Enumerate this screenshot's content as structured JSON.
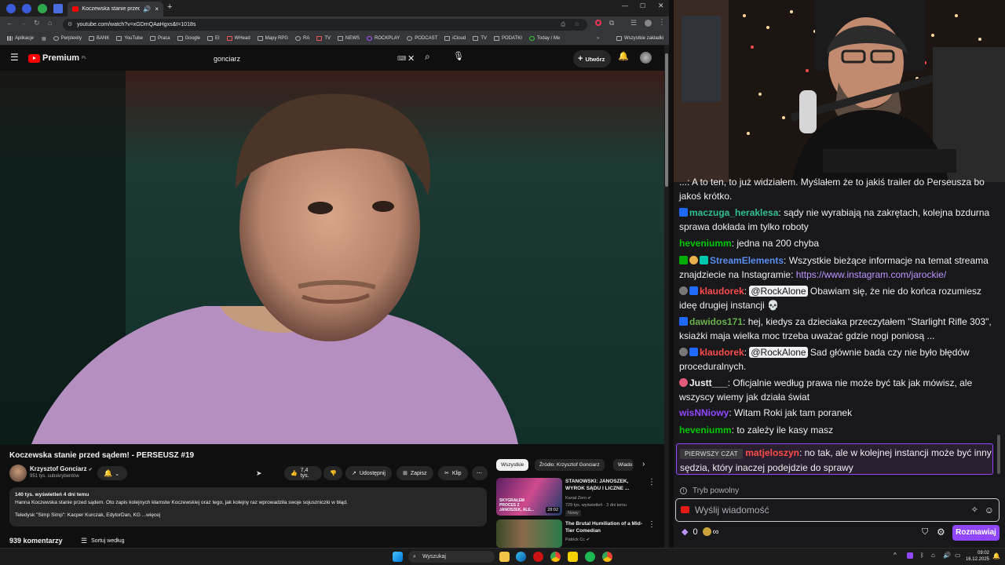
{
  "browser": {
    "tab_title": "Koczewska stanie przed są",
    "url": "youtube.com/watch?v=xGDmQAaHgxs&t=1018s",
    "bookmarks": [
      "Aplikacje",
      "Perplexity",
      "BANK",
      "YouTube",
      "Praca",
      "Google",
      "EI",
      "WHead",
      "Mapy RPG",
      "RA",
      "TV",
      "NEWS",
      "ROCKPLAY",
      "PODCAST",
      "iCloud",
      "TV",
      "PODATKI",
      "Today / Me"
    ],
    "all_bookmarks": "Wszystkie zakładki"
  },
  "yt": {
    "logo_text": "Premium",
    "logo_sup": "PL",
    "search_value": "gonciarz",
    "create_label": "Utwórz",
    "video_title": "Koczewska stanie przed sądem! - PERSEUSZ #19",
    "channel_name": "Krzysztof Gonciarz",
    "subs": "951 tys. subskrybentów",
    "likes": "7,4 tys.",
    "share_label": "Udostępnij",
    "save_label": "Zapisz",
    "clip_label": "Klip",
    "desc_stats": "140 tys. wyświetleń  4 dni temu",
    "desc_line1": "Hanna Koczewska stanie przed sądem. Oto zapis kolejnych kłamstw Koczewskiej oraz tego, jak kolejny raz wprowadziła swoje sojuszniczki w błąd.",
    "desc_line2": "Teledysk \"Simp Simp\": Kacper Kurczak, EdytorDan, KG ...więcej",
    "comments_count": "939 komentarzy",
    "sort_label": "Sortuj według",
    "chips": [
      "Wszystkie",
      "Źródło: Krzysztof Gonciarz",
      "Wiado"
    ],
    "recs": [
      {
        "title": "STANOWSKI: JANOSZEK, WYROK SĄDU I LICZNE ...",
        "channel": "Kanał Zero",
        "meta": "729 tys. wyświetleń · 3 dni temu",
        "badge": "Nowy",
        "duration": "28:02",
        "thumb_text": "SKYGRAŁEM PROCES Z JANOSZEK, ALE..."
      },
      {
        "title": "The Brutal Humiliation of a Mid-Tier Comedian",
        "channel": "Patrick Cc",
        "meta": "",
        "badge": "",
        "duration": "",
        "thumb_text": ""
      }
    ]
  },
  "chat": {
    "partial_top": "...: A to ten, to już widziałem. Myślałem że to jakiś trailer do Perseusza bo jakoś krótko.",
    "messages": [
      {
        "user": "maczuga_heraklesa",
        "color": "#2fbf8f",
        "text": ": sądy nie wyrabiają na zakrętach, kolejna bzdurna sprawa dokłada im tylko roboty"
      },
      {
        "user": "heveniumm",
        "color": "#00c800",
        "text": ": jedna na 200 chyba"
      },
      {
        "user": "StreamElements",
        "color": "#5a8dee",
        "text": ": Wszystkie bieżące informacje na temat streama znajdziecie na Instagramie: ",
        "link": "https://www.instagram.com/jarockie/"
      },
      {
        "user": "klaudorek",
        "color": "#ff4b4b",
        "mention": "@RockAlone",
        "text": " Obawiam się, że nie do końca rozumiesz ideę drugiej instancji 💀"
      },
      {
        "user": "dawidos171",
        "color": "#6ab04c",
        "text": ": hej, kiedys za dzieciaka przeczytałem \"Starlight Rifle 303\", ksiażki maja wielka moc trzeba uważać gdzie nogi poniosą ..."
      },
      {
        "user": "klaudorek",
        "color": "#ff4b4b",
        "mention": "@RockAlone",
        "text": " Sad głównie bada czy nie było błędów proceduralnych."
      },
      {
        "user": "Justt___",
        "color": "#efeff1",
        "text": ": Oficjalnie według prawa nie może być tak jak mówisz, ale wszyscy wiemy jak działa świat"
      },
      {
        "user": "wisNNiowy",
        "color": "#9147ff",
        "text": ": Witam Roki jak tam poranek"
      },
      {
        "user": "heveniumm",
        "color": "#00c800",
        "text": ": to zależy ile kasy masz"
      }
    ],
    "first_chat_badge": "PIERWSZY CZAT",
    "first_chat_user": "matjeloszyn",
    "first_chat_text": ": no tak, ale w kolejnej instancji może być inny sędzia, który inaczej podejdzie do sprawy",
    "slow_mode": "Tryb powolny",
    "input_placeholder": "Wyślij wiadomość",
    "points": "0",
    "chat_button": "Rozmawiaj"
  },
  "taskbar": {
    "search_label": "Wyszukaj",
    "time": "09:02",
    "date": "16.12.2025"
  }
}
